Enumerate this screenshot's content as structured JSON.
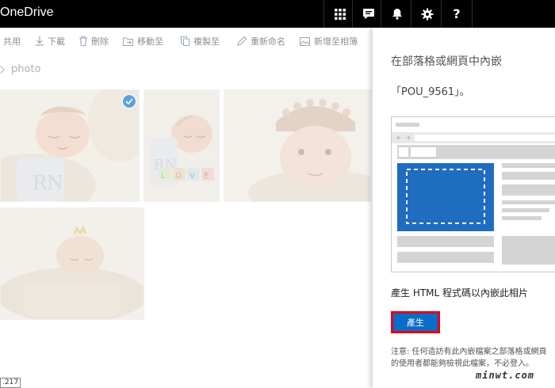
{
  "app": {
    "title": "OneDrive"
  },
  "topbar_icons": [
    "app-launcher-icon",
    "chat-icon",
    "bell-icon",
    "gear-icon",
    "help-icon"
  ],
  "help_glyph": "?",
  "commands": [
    {
      "label": "共用",
      "icon": "share-icon"
    },
    {
      "label": "下載",
      "icon": "download-icon"
    },
    {
      "label": "刪除",
      "icon": "trash-icon"
    },
    {
      "label": "移動至",
      "icon": "move-icon"
    },
    {
      "label": "複製至",
      "icon": "copy-icon"
    },
    {
      "label": "重新命名",
      "icon": "rename-icon"
    },
    {
      "label": "新增至相簿",
      "icon": "album-icon"
    }
  ],
  "breadcrumb": {
    "current": "photo"
  },
  "photos": [
    {
      "selected": true
    },
    {
      "selected": false
    },
    {
      "selected": false
    },
    {
      "selected": false
    }
  ],
  "status": {
    "text": ".217"
  },
  "embed_pane": {
    "title": "在部落格或網頁中內嵌",
    "file_name": "「POU_9561」。",
    "generate_label": "產生 HTML 程式碼以內嵌此相片",
    "generate_button": "產生",
    "note_line1": "注意: 任何造訪有此內嵌檔案之部落格或網頁",
    "note_line2": "的使用者都能夠檢視此檔案，不必登入。"
  },
  "watermark": "minwt.com",
  "colors": {
    "topbar": "#000000",
    "accent": "#0a6cc9",
    "highlight": "#e60012"
  }
}
